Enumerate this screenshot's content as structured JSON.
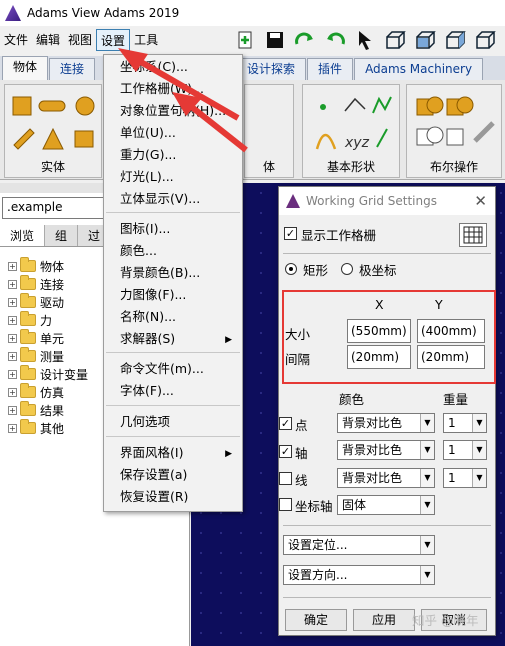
{
  "window": {
    "title": "Adams View Adams 2019"
  },
  "menubar": {
    "items": [
      {
        "name": "menu-file",
        "label": "文件"
      },
      {
        "name": "menu-edit",
        "label": "编辑"
      },
      {
        "name": "menu-view",
        "label": "视图"
      },
      {
        "name": "menu-settings",
        "label": "设置"
      },
      {
        "name": "menu-tools",
        "label": "工具"
      }
    ]
  },
  "ribbon_tabs": [
    "物体",
    "连接",
    "设计探索",
    "插件",
    "Adams Machinery"
  ],
  "ribbon_groups": {
    "bodies": "实体",
    "basic_shapes": "基本形状",
    "boolean": "布尔操作",
    "partial": "体"
  },
  "left_pane": {
    "model": ".example",
    "tabs": [
      "浏览",
      "组",
      "过"
    ],
    "tree": [
      "物体",
      "连接",
      "驱动",
      "力",
      "单元",
      "测量",
      "设计变量",
      "仿真",
      "结果",
      "其他"
    ]
  },
  "settings_menu": {
    "items": [
      "坐标系(C)...",
      "工作格栅(W)...",
      "对象位置句柄(H)...",
      "单位(U)...",
      "重力(G)...",
      "灯光(L)...",
      "立体显示(V)...",
      "图标(I)...",
      "颜色...",
      "背景颜色(B)...",
      "力图像(F)...",
      "名称(N)...",
      "求解器(S)",
      "命令文件(m)...",
      "字体(F)...",
      "几何选项",
      "界面风格(I)",
      "保存设置(a)",
      "恢复设置(R)"
    ]
  },
  "dialog": {
    "title": "Working Grid Settings",
    "show_grid_label": "显示工作格栅",
    "rect_label": "矩形",
    "polar_label": "极坐标",
    "col_x": "X",
    "col_y": "Y",
    "size_label": "大小",
    "spacing_label": "间隔",
    "size_x": "(550mm)",
    "size_y": "(400mm)",
    "spacing_x": "(20mm)",
    "spacing_y": "(20mm)",
    "color_header": "颜色",
    "weight_header": "重量",
    "rows": [
      {
        "label": "点",
        "checked": "✓",
        "color": "背景对比色",
        "weight": "1"
      },
      {
        "label": "轴",
        "checked": "✓",
        "color": "背景对比色",
        "weight": "1"
      },
      {
        "label": "线",
        "checked": "",
        "color": "背景对比色",
        "weight": "1"
      }
    ],
    "axis_label": "坐标轴",
    "axis_style": "固体",
    "set_location": "设置定位...",
    "set_orientation": "设置方向...",
    "ok": "确定",
    "apply": "应用",
    "cancel": "取消"
  },
  "watermark": "知乎 @晓年",
  "colors": {
    "highlight": "#e53935",
    "arrow": "#e53935",
    "viewport": "#0d0d5c"
  }
}
